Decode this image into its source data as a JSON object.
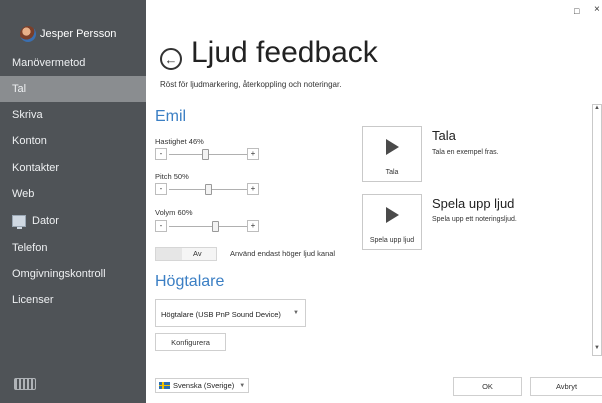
{
  "window": {
    "maximize_glyph": "□",
    "close_glyph": "×"
  },
  "sidebar": {
    "user_name": "Jesper Persson",
    "items": [
      {
        "label": "Manövermetod"
      },
      {
        "label": "Tal"
      },
      {
        "label": "Skriva"
      },
      {
        "label": "Konton"
      },
      {
        "label": "Kontakter"
      },
      {
        "label": "Web"
      },
      {
        "label": "Dator"
      },
      {
        "label": "Telefon"
      },
      {
        "label": "Omgivningskontroll"
      },
      {
        "label": "Licenser"
      }
    ],
    "active_item": "Tal"
  },
  "header": {
    "back_glyph": "←",
    "title": "Ljud feedback",
    "subtitle": "Röst för ljudmarkering, återkoppling och noteringar."
  },
  "emil": {
    "title": "Emil",
    "speed": {
      "label": "Hastighet 46%",
      "value_percent": 46
    },
    "pitch": {
      "label": "Pitch 50%",
      "value_percent": 50
    },
    "volume": {
      "label": "Volym 60%",
      "value_percent": 60
    },
    "minus": "-",
    "plus": "+",
    "toggle_state": "Av",
    "toggle_label": "Använd endast höger ljud kanal"
  },
  "speakers": {
    "title": "Högtalare",
    "device": "Högtalare (USB PnP Sound Device)",
    "configure": "Konfigurera"
  },
  "actions": {
    "speak": {
      "tile_label": "Tala",
      "title": "Tala",
      "desc": "Tala en exempel fras."
    },
    "play": {
      "tile_label": "Spela upp ljud",
      "title": "Spela upp ljud",
      "desc": "Spela upp ett noteringsljud."
    }
  },
  "footer": {
    "language": "Svenska (Sverige)",
    "ok": "OK",
    "cancel": "Avbryt"
  },
  "colors": {
    "sidebar_bg": "#4f5357",
    "active_bg": "#8a8d90",
    "accent": "#3b7fc4"
  }
}
